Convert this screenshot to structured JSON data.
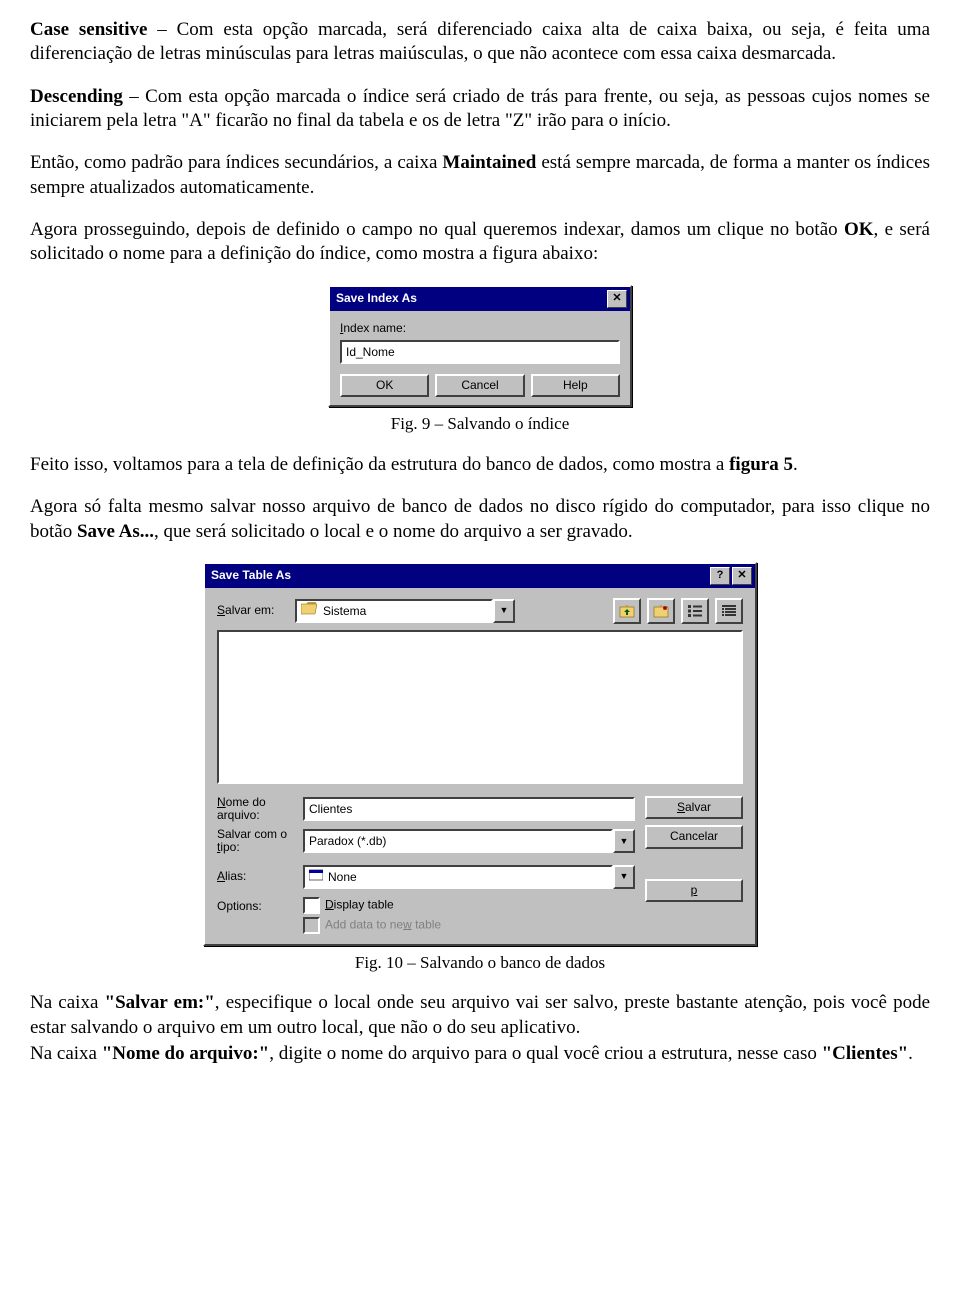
{
  "paragraphs": {
    "p1_bold": "Case sensitive",
    "p1_rest": " – Com esta opção marcada, será diferenciado caixa alta de caixa baixa, ou seja, é feita uma diferenciação de letras minúsculas para letras maiúsculas, o que não acontece com essa caixa desmarcada.",
    "p2_bold": "Descending",
    "p2_rest": " – Com esta opção marcada o índice será criado de trás para frente, ou seja, as pessoas cujos nomes se iniciarem pela letra \"A\" ficarão no final da tabela e os de letra \"Z\" irão para o início.",
    "p3_a": "Então, como padrão para índices secundários, a caixa ",
    "p3_bold": "Maintained",
    "p3_b": " está sempre marcada, de forma a manter os índices sempre atualizados automaticamente.",
    "p4_a": "Agora prosseguindo, depois de definido o campo no qual queremos indexar, damos um clique no botão ",
    "p4_bold": "OK",
    "p4_b": ", e será solicitado o nome para a definição do índice, como mostra a figura abaixo:",
    "fig9": "Fig. 9 – Salvando o índice",
    "p5_a": "Feito isso, voltamos para a tela de definição da estrutura do banco de dados, como mostra a ",
    "p5_bold": "figura 5",
    "p5_b": ".",
    "p6_a": "Agora só falta mesmo salvar nosso arquivo de banco de dados no disco rígido do computador, para isso clique no botão ",
    "p6_bold": "Save As...",
    "p6_b": ", que será solicitado o local e o nome do arquivo a ser gravado.",
    "fig10": "Fig. 10 – Salvando o banco de dados",
    "p7_a": "Na caixa ",
    "p7_bold1": "\"Salvar em:\"",
    "p7_b": ", especifique o local onde seu arquivo vai ser salvo, preste bastante atenção, pois você pode estar salvando o arquivo em um outro local, que não o do seu aplicativo.",
    "p8_a": "Na caixa ",
    "p8_bold1": "\"Nome do arquivo:\"",
    "p8_b": ", digite o nome do arquivo para o qual você criou a estrutura, nesse caso ",
    "p8_bold2": "\"Clientes\"",
    "p8_c": "."
  },
  "dialog1": {
    "title": "Save Index As",
    "index_label": "Index name:",
    "index_value": "Id_Nome",
    "btn_ok": "OK",
    "btn_cancel": "Cancel",
    "btn_help": "Help",
    "close_icon": "✕"
  },
  "dialog2": {
    "title": "Save Table As",
    "salvar_em_label": "Salvar em:",
    "salvar_em_value": "Sistema",
    "nome_label1": "Nome do",
    "nome_label2": "arquivo:",
    "nome_value": "Clientes",
    "tipo_label1": "Salvar com o",
    "tipo_label2": "tipo:",
    "tipo_value": "Paradox (*.db)",
    "alias_label": "Alias:",
    "alias_value": "None",
    "options_label": "Options:",
    "opt1": "Display table",
    "opt2": "Add data to new table",
    "btn_salvar": "Salvar",
    "btn_cancelar": "Cancelar",
    "btn_p": "p",
    "help_icon": "?",
    "close_icon": "✕",
    "dropdown_glyph": "▼"
  }
}
